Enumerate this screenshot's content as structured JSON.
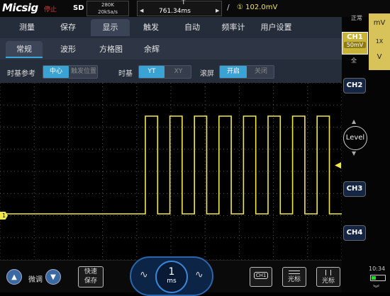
{
  "topbar": {
    "brand": "Micsig",
    "run_state": "停止",
    "storage_mode": "SD",
    "memory_depth": "280K",
    "sample_rate": "20kSa/s",
    "timebase_tag": "T",
    "timebase_offset": "761.34ms",
    "timebase_left": "◀",
    "timebase_right": "▶",
    "trigger_slope": "/",
    "trigger_level": "① 102.0mV"
  },
  "menu": {
    "tabs": [
      "测量",
      "保存",
      "显示",
      "触发",
      "自动",
      "频率计",
      "用户设置"
    ],
    "active_tab": "显示"
  },
  "submenu": {
    "tabs": [
      "常规",
      "波形",
      "方格图",
      "余辉"
    ],
    "active_tab": "常规"
  },
  "options": {
    "time_ref_label": "时基参考",
    "time_ref_opt1": "中心",
    "time_ref_opt2": "触发位置",
    "timebase_label": "时基",
    "timebase_opt1": "YT",
    "timebase_opt2": "XY",
    "roll_label": "滚屏",
    "roll_opt1": "开启",
    "roll_opt2": "关闭"
  },
  "waveform": {
    "channel_marker": "1",
    "color": "#f2e84c",
    "cycles": 8
  },
  "right_panel": {
    "acq_mode": "正常",
    "ch1_label": "CH1",
    "ch1_scale": "50mV",
    "bandwidth": "全",
    "vertical_unit_up": "mV",
    "probe": "1X",
    "vertical_unit_down": "V",
    "ch2": "CH2",
    "level": "Level",
    "ch3": "CH3",
    "ch4": "CH4"
  },
  "bottombar": {
    "fine_label": "微调",
    "quick_save": "快速\n保存",
    "timebase_value": "1",
    "timebase_unit": "ms",
    "ch1_btn": "CH1",
    "cursor1": "光标",
    "cursor2": "光标",
    "time": "10:34"
  }
}
